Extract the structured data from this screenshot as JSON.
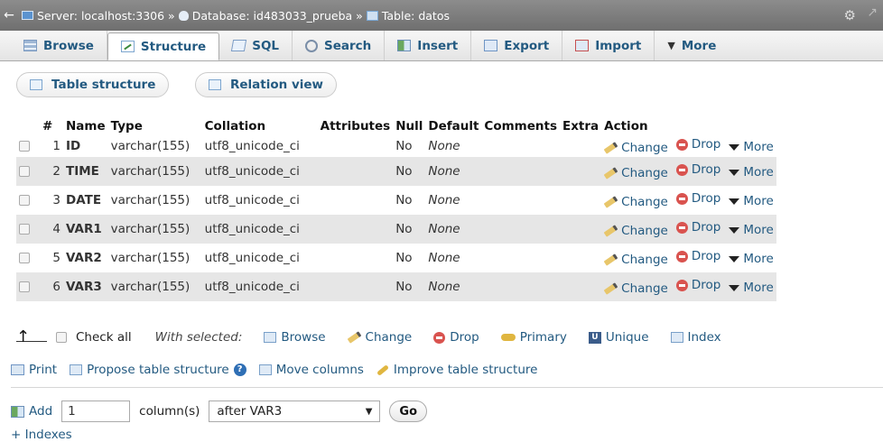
{
  "breadcrumb": {
    "server": "Server: localhost:3306 »",
    "database": "Database: id483033_prueba »",
    "table": "Table: datos"
  },
  "tabs": [
    {
      "label": "Browse",
      "icon": "browse-icon"
    },
    {
      "label": "Structure",
      "icon": "structure-icon",
      "active": true
    },
    {
      "label": "SQL",
      "icon": "sql-icon"
    },
    {
      "label": "Search",
      "icon": "search-icon"
    },
    {
      "label": "Insert",
      "icon": "insert-icon"
    },
    {
      "label": "Export",
      "icon": "export-icon"
    },
    {
      "label": "Import",
      "icon": "import-icon"
    },
    {
      "label": "More",
      "icon": "chevron-down-icon"
    }
  ],
  "subtabs": {
    "table_structure": "Table structure",
    "relation_view": "Relation view"
  },
  "table": {
    "headers": [
      "#",
      "Name",
      "Type",
      "Collation",
      "Attributes",
      "Null",
      "Default",
      "Comments",
      "Extra",
      "Action"
    ],
    "rows": [
      {
        "num": "1",
        "name": "ID",
        "type": "varchar(155)",
        "collation": "utf8_unicode_ci",
        "null": "No",
        "default": "None"
      },
      {
        "num": "2",
        "name": "TIME",
        "type": "varchar(155)",
        "collation": "utf8_unicode_ci",
        "null": "No",
        "default": "None"
      },
      {
        "num": "3",
        "name": "DATE",
        "type": "varchar(155)",
        "collation": "utf8_unicode_ci",
        "null": "No",
        "default": "None"
      },
      {
        "num": "4",
        "name": "VAR1",
        "type": "varchar(155)",
        "collation": "utf8_unicode_ci",
        "null": "No",
        "default": "None"
      },
      {
        "num": "5",
        "name": "VAR2",
        "type": "varchar(155)",
        "collation": "utf8_unicode_ci",
        "null": "No",
        "default": "None"
      },
      {
        "num": "6",
        "name": "VAR3",
        "type": "varchar(155)",
        "collation": "utf8_unicode_ci",
        "null": "No",
        "default": "None"
      }
    ],
    "actions": {
      "change": "Change",
      "drop": "Drop",
      "more": "More"
    }
  },
  "bulk": {
    "check_all": "Check all",
    "with_selected": "With selected:",
    "browse": "Browse",
    "change": "Change",
    "drop": "Drop",
    "primary": "Primary",
    "unique": "Unique",
    "index": "Index"
  },
  "tools": {
    "print": "Print",
    "propose": "Propose table structure",
    "move_columns": "Move columns",
    "improve": "Improve table structure"
  },
  "add_column": {
    "add_label": "Add",
    "count_value": "1",
    "columns_label": "column(s)",
    "position_selected": "after VAR3",
    "go_label": "Go"
  },
  "indexes_link": "+ Indexes"
}
